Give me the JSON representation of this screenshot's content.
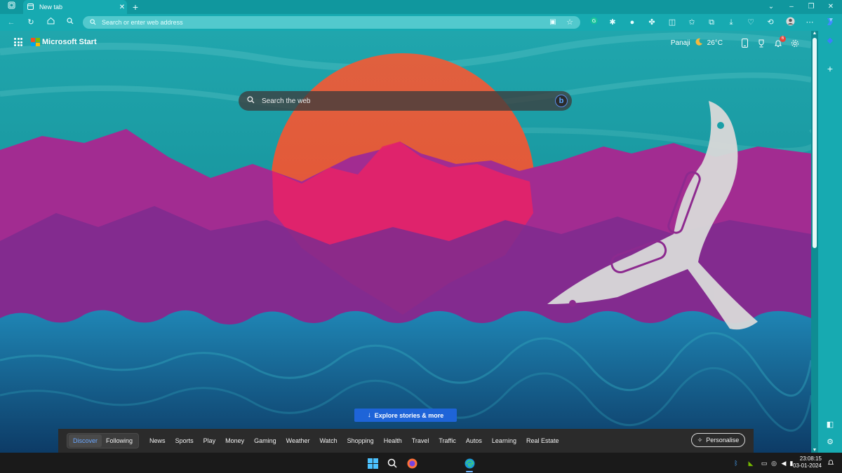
{
  "browser": {
    "tab_title": "New tab",
    "tab_close": "✕",
    "new_tab": "+",
    "address_placeholder": "Search or enter web address"
  },
  "msn": {
    "brand": "Microsoft Start",
    "city": "Panaji",
    "temp": "26°C",
    "notification_count": "6",
    "search_placeholder": "Search the web",
    "explore_label": "Explore stories & more",
    "feed_tabs": [
      "Discover",
      "Following"
    ],
    "nav": [
      "News",
      "Sports",
      "Play",
      "Money",
      "Gaming",
      "Weather",
      "Watch",
      "Shopping",
      "Health",
      "Travel",
      "Traffic",
      "Autos",
      "Learning",
      "Real Estate"
    ],
    "personalise": "Personalise"
  },
  "taskbar": {
    "time": "23:08:15",
    "date": "03-01-2024"
  },
  "colors": {
    "browser_teal": "#17aab1",
    "accent_blue": "#1e64d8",
    "active_tab_text": "#6aa7ff"
  }
}
